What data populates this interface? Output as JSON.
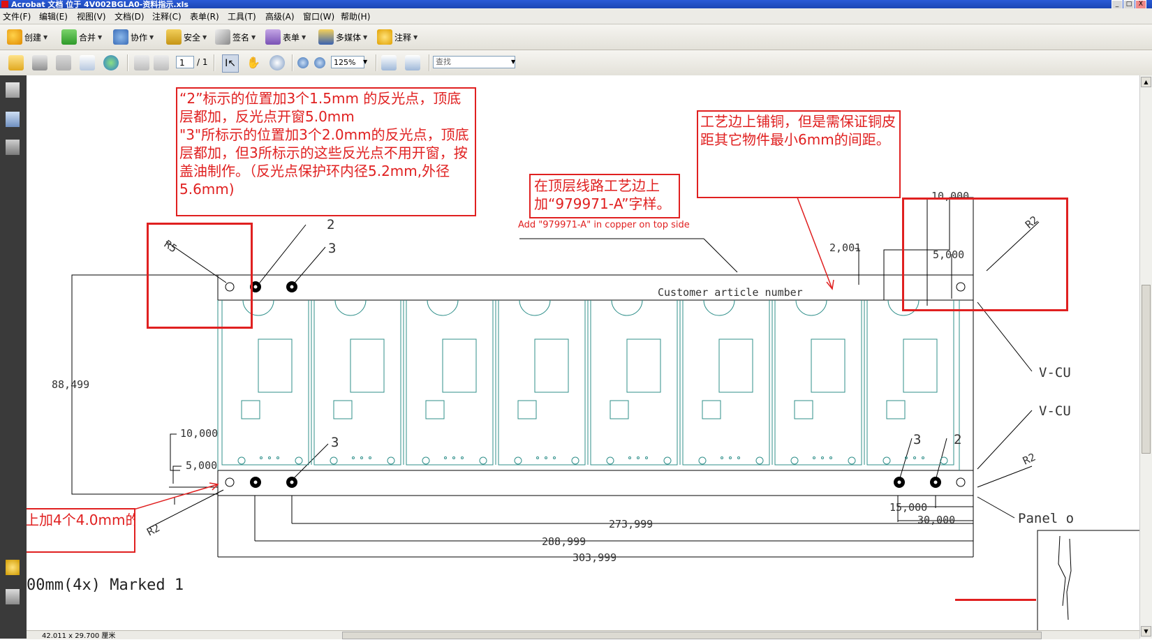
{
  "window": {
    "title": "Acrobat 文档 位于 4V002BGLA0-资料指示.xls",
    "minimize": "_",
    "maximize": "□",
    "close": "X"
  },
  "menu": [
    "文件(F)",
    "编辑(E)",
    "视图(V)",
    "文档(D)",
    "注释(C)",
    "表单(R)",
    "工具(T)",
    "高级(A)",
    "窗口(W)",
    "帮助(H)"
  ],
  "toolbar1": {
    "create": "创建",
    "combine": "合并",
    "collaborate": "协作",
    "secure": "安全",
    "sign": "签名",
    "forms": "表单",
    "multimedia": "多媒体",
    "comment": "注释"
  },
  "toolbar2": {
    "page_current": "1",
    "page_total": "/ 1",
    "zoom": "125%",
    "find_placeholder": "查找"
  },
  "status": {
    "page_size": "42.011 x 29.700 厘米"
  },
  "notes": {
    "fiducials": "“2”标示的位置加3个1.5mm 的反光点，顶底层都加，反光点开窗5.0mm\n\"3\"所标示的位置加3个2.0mm的反光点，顶底层都加，但3所标示的这些反光点不用开窗，按盖油制作。（反光点保护环内径5.2mm,外径5.6mm)",
    "copper": "工艺边上铺铜，但是需保证铜皮距其它物件最小6mm的间距。",
    "part_no": "在顶层线路工艺边上加“979971-A”字样。",
    "part_no_en": "Add \"979971-A\" in copper on top side",
    "holes": "上加4个4.0mm的"
  },
  "drawing": {
    "customer_text": "Customer article number",
    "dim_88": "88,499",
    "dim_10a": "10,000",
    "dim_5a": "5,000",
    "dim_10b": "10,000",
    "dim_5b": "5,000",
    "dim_2": "2,001",
    "dim_15": "15,000",
    "dim_30": "30,000",
    "dim_273": "273,999",
    "dim_288": "288,999",
    "dim_303": "303,999",
    "label_r5": "R5",
    "label_r2a": "R2",
    "label_r2b": "R2",
    "label_r2c": "R2",
    "label_2a": "2",
    "label_3a": "3",
    "label_3b": "3",
    "label_3c": "3",
    "label_2b": "2",
    "vcut1": "V-CU",
    "vcut2": "V-CU",
    "panel": "Panel o",
    "bottom_text": "00mm(4x)  Marked 1"
  }
}
